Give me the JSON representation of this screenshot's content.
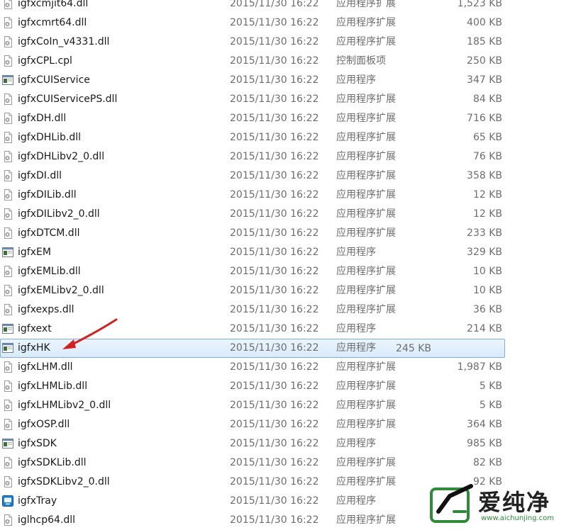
{
  "files": [
    {
      "name": "igfxcmjit64.dll",
      "date": "2015/11/30 16:22",
      "type": "应用程序扩展",
      "size": "1,523 KB",
      "icon": "dll-file-icon"
    },
    {
      "name": "igfxcmrt64.dll",
      "date": "2015/11/30 16:22",
      "type": "应用程序扩展",
      "size": "400 KB",
      "icon": "dll-file-icon"
    },
    {
      "name": "igfxCoIn_v4331.dll",
      "date": "2015/11/30 16:22",
      "type": "应用程序扩展",
      "size": "185 KB",
      "icon": "dll-file-icon"
    },
    {
      "name": "igfxCPL.cpl",
      "date": "2015/11/30 16:22",
      "type": "控制面板项",
      "size": "250 KB",
      "icon": "dll-file-icon"
    },
    {
      "name": "igfxCUIService",
      "date": "2015/11/30 16:22",
      "type": "应用程序",
      "size": "347 KB",
      "icon": "exe-file-icon"
    },
    {
      "name": "igfxCUIServicePS.dll",
      "date": "2015/11/30 16:22",
      "type": "应用程序扩展",
      "size": "84 KB",
      "icon": "dll-file-icon"
    },
    {
      "name": "igfxDH.dll",
      "date": "2015/11/30 16:22",
      "type": "应用程序扩展",
      "size": "716 KB",
      "icon": "dll-file-icon"
    },
    {
      "name": "igfxDHLib.dll",
      "date": "2015/11/30 16:22",
      "type": "应用程序扩展",
      "size": "65 KB",
      "icon": "dll-file-icon"
    },
    {
      "name": "igfxDHLibv2_0.dll",
      "date": "2015/11/30 16:22",
      "type": "应用程序扩展",
      "size": "76 KB",
      "icon": "dll-file-icon"
    },
    {
      "name": "igfxDI.dll",
      "date": "2015/11/30 16:22",
      "type": "应用程序扩展",
      "size": "358 KB",
      "icon": "dll-file-icon"
    },
    {
      "name": "igfxDILib.dll",
      "date": "2015/11/30 16:22",
      "type": "应用程序扩展",
      "size": "12 KB",
      "icon": "dll-file-icon"
    },
    {
      "name": "igfxDILibv2_0.dll",
      "date": "2015/11/30 16:22",
      "type": "应用程序扩展",
      "size": "12 KB",
      "icon": "dll-file-icon"
    },
    {
      "name": "igfxDTCM.dll",
      "date": "2015/11/30 16:22",
      "type": "应用程序扩展",
      "size": "233 KB",
      "icon": "dll-file-icon"
    },
    {
      "name": "igfxEM",
      "date": "2015/11/30 16:22",
      "type": "应用程序",
      "size": "329 KB",
      "icon": "exe-file-icon"
    },
    {
      "name": "igfxEMLib.dll",
      "date": "2015/11/30 16:22",
      "type": "应用程序扩展",
      "size": "10 KB",
      "icon": "dll-file-icon"
    },
    {
      "name": "igfxEMLibv2_0.dll",
      "date": "2015/11/30 16:22",
      "type": "应用程序扩展",
      "size": "10 KB",
      "icon": "dll-file-icon"
    },
    {
      "name": "igfxexps.dll",
      "date": "2015/11/30 16:22",
      "type": "应用程序扩展",
      "size": "36 KB",
      "icon": "dll-file-icon"
    },
    {
      "name": "igfxext",
      "date": "2015/11/30 16:22",
      "type": "应用程序",
      "size": "214 KB",
      "icon": "exe-file-icon"
    },
    {
      "name": "igfxHK",
      "date": "2015/11/30 16:22",
      "type": "应用程序",
      "size": "245 KB",
      "icon": "exe-file-icon",
      "selected": true
    },
    {
      "name": "igfxLHM.dll",
      "date": "2015/11/30 16:22",
      "type": "应用程序扩展",
      "size": "1,987 KB",
      "icon": "dll-file-icon"
    },
    {
      "name": "igfxLHMLib.dll",
      "date": "2015/11/30 16:22",
      "type": "应用程序扩展",
      "size": "5 KB",
      "icon": "dll-file-icon"
    },
    {
      "name": "igfxLHMLibv2_0.dll",
      "date": "2015/11/30 16:22",
      "type": "应用程序扩展",
      "size": "5 KB",
      "icon": "dll-file-icon"
    },
    {
      "name": "igfxOSP.dll",
      "date": "2015/11/30 16:22",
      "type": "应用程序扩展",
      "size": "364 KB",
      "icon": "dll-file-icon"
    },
    {
      "name": "igfxSDK",
      "date": "2015/11/30 16:22",
      "type": "应用程序",
      "size": "985 KB",
      "icon": "exe-file-icon"
    },
    {
      "name": "igfxSDKLib.dll",
      "date": "2015/11/30 16:22",
      "type": "应用程序扩展",
      "size": "82 KB",
      "icon": "dll-file-icon"
    },
    {
      "name": "igfxSDKLibv2_0.dll",
      "date": "2015/11/30 16:22",
      "type": "应用程序扩展",
      "size": "92 KB",
      "icon": "dll-file-icon"
    },
    {
      "name": "igfxTray",
      "date": "2015/11/30 16:22",
      "type": "应用程序",
      "size": "",
      "icon": "tray-app-icon"
    },
    {
      "name": "iglhcp64.dll",
      "date": "2015/11/30 16:22",
      "type": "应用程序扩展",
      "size": "",
      "icon": "dll-file-icon"
    }
  ],
  "watermark": {
    "text": "爱纯净",
    "url": "www.aichunjing.com"
  },
  "colors": {
    "selection_border": "#84acdd",
    "selection_fill": "#dcebfc",
    "arrow": "#d42020",
    "watermark_green": "#2f8a3a"
  }
}
